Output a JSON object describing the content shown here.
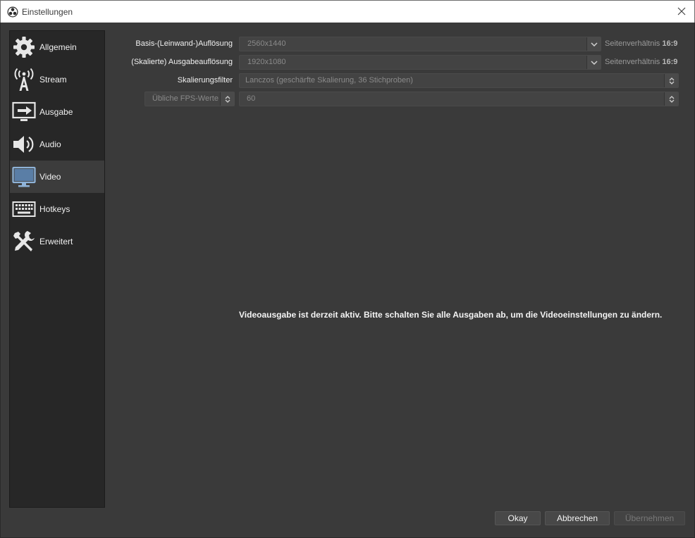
{
  "window": {
    "title": "Einstellungen"
  },
  "sidebar": {
    "items": [
      {
        "label": "Allgemein",
        "icon": "gear-icon"
      },
      {
        "label": "Stream",
        "icon": "antenna-icon"
      },
      {
        "label": "Ausgabe",
        "icon": "output-icon"
      },
      {
        "label": "Audio",
        "icon": "speaker-icon"
      },
      {
        "label": "Video",
        "icon": "monitor-icon",
        "active": true
      },
      {
        "label": "Hotkeys",
        "icon": "keyboard-icon"
      },
      {
        "label": "Erweitert",
        "icon": "tools-icon"
      }
    ]
  },
  "video": {
    "base_label": "Basis-(Leinwand-)Auflösung",
    "base_value": "2560x1440",
    "base_aspect_prefix": "Seitenverhältnis",
    "base_aspect_value": "16:9",
    "output_label": "(Skalierte) Ausgabeauflösung",
    "output_value": "1920x1080",
    "output_aspect_prefix": "Seitenverhältnis",
    "output_aspect_value": "16:9",
    "filter_label": "Skalierungsfilter",
    "filter_value": "Lanczos (geschärfte Skalierung, 36 Stichproben)",
    "fps_type": "Übliche FPS-Werte",
    "fps_value": "60",
    "message": "Videoausgabe ist derzeit aktiv. Bitte schalten Sie alle Ausgaben ab, um die Videoeinstellungen zu ändern."
  },
  "buttons": {
    "ok": "Okay",
    "cancel": "Abbrechen",
    "apply": "Übernehmen"
  },
  "colors": {
    "background": "#3a3a3a",
    "sidebar": "#272727",
    "active_item": "#3c3c3c"
  }
}
